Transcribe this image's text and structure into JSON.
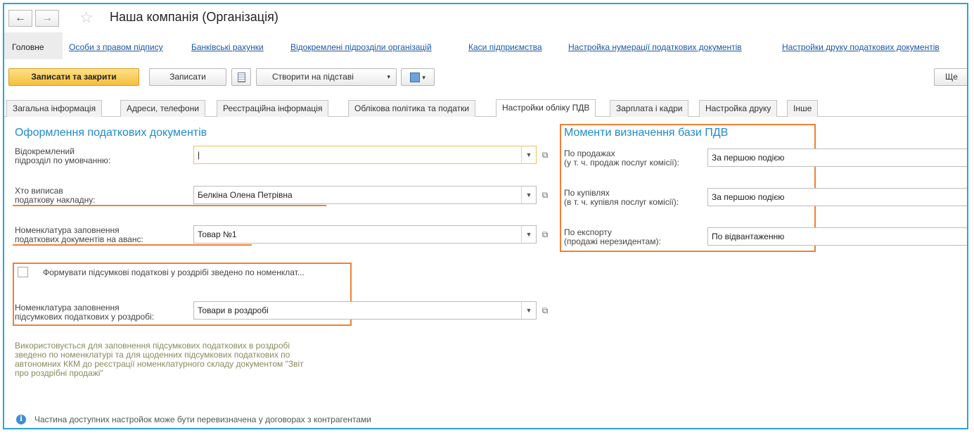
{
  "window": {
    "title": "Наша компанія (Організація)"
  },
  "nav": {
    "back_icon": "arrow-left-icon",
    "forward_icon": "arrow-right-icon",
    "favorite_icon": "star-icon"
  },
  "links": [
    "Головне",
    "Особи з правом підпису",
    "Банківські рахунки",
    "Відокремлені підрозділи організацій",
    "Каси підприємства",
    "Настройка нумерації податкових документів",
    "Настройки друку податкових документів"
  ],
  "toolbar": {
    "save_close": "Записати та закрити",
    "save": "Записати",
    "create_based": "Створити на підставі",
    "more": "Ще"
  },
  "tabs": [
    "Загальна інформація",
    "Адреси, телефони",
    "Реєстраційна інформація",
    "Облікова політика та податки",
    "Настройки обліку ПДВ",
    "Зарплата і кадри",
    "Настройка друку",
    "Інше"
  ],
  "left_section": {
    "title": "Оформлення податкових документів",
    "fields": [
      {
        "label1": "Відокремлений",
        "label2": "підрозділ по умовчанню:",
        "value": "|"
      },
      {
        "label1": "Хто виписав",
        "label2": "податкову накладну:",
        "value": "Белкіна Олена Петрівна"
      },
      {
        "label1": "Номенклатура заповнення",
        "label2": "податкових документів на аванс:",
        "value": "Товар №1"
      }
    ],
    "checkbox_label": "Формувати підсумкові податкові у роздрібі зведено по номенклат...",
    "retail_field": {
      "label1": "Номенклатура заповнення",
      "label2": "підсумкових податкових у роздробі:",
      "value": "Товари в роздробі"
    },
    "note": [
      "Використовується для заповнення підсумкових податкових в роздробі",
      "зведено по номенклатурі та для щоденних підсумкових податкових по",
      "автономних ККМ до реєстрації номенклатурного складу документом \"Звіт",
      "про роздрібні продажі\""
    ]
  },
  "right_section": {
    "title": "Моменти визначення бази ПДВ",
    "fields": [
      {
        "label1": "По продажах",
        "label2": "(у т. ч. продаж послуг комісії):",
        "value": "За першою подією"
      },
      {
        "label1": "По купівлях",
        "label2": "(в т. ч. купівля послуг комісії):",
        "value": "За першою подією"
      },
      {
        "label1": "По експорту",
        "label2": "(продажі нерезидентам):",
        "value": "По відвантаженню"
      }
    ]
  },
  "footer_info": "Частина доступних настройок може бути перевизначена у договорах з контрагентами",
  "colors": {
    "accent": "#1f8bcc",
    "highlight": "#f08033",
    "primary_button": "#f5be3c",
    "frame": "#2aa3df"
  }
}
